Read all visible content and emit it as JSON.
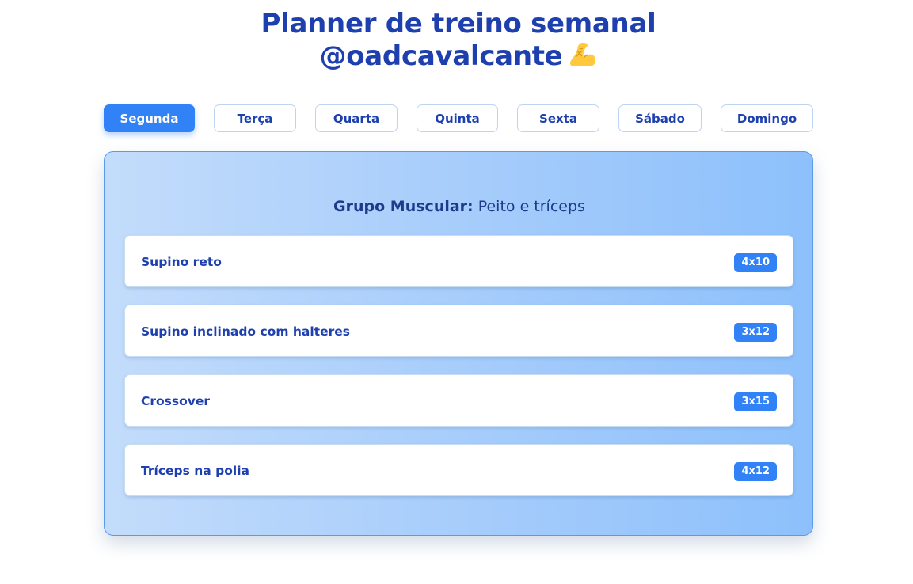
{
  "header": {
    "title_line1": "Planner de treino semanal",
    "title_line2": "@oadcavalcante",
    "emoji_icon": "flexed-biceps-icon"
  },
  "tabs": [
    {
      "label": "Segunda",
      "active": true
    },
    {
      "label": "Terça",
      "active": false
    },
    {
      "label": "Quarta",
      "active": false
    },
    {
      "label": "Quinta",
      "active": false
    },
    {
      "label": "Sexta",
      "active": false
    },
    {
      "label": "Sábado",
      "active": false
    },
    {
      "label": "Domingo",
      "active": false
    }
  ],
  "workout": {
    "group_key": "Grupo Muscular:",
    "group_value": "Peito e tríceps",
    "exercises": [
      {
        "name": "Supino reto",
        "sets": "4x10"
      },
      {
        "name": "Supino inclinado com halteres",
        "sets": "3x12"
      },
      {
        "name": "Crossover",
        "sets": "3x15"
      },
      {
        "name": "Tríceps na polia",
        "sets": "4x12"
      }
    ]
  },
  "colors": {
    "primary": "#3182f6",
    "heading": "#1e40af",
    "panel_start": "#c3dcfb",
    "panel_end": "#8dc0fb",
    "panel_border": "#5a9be8"
  }
}
